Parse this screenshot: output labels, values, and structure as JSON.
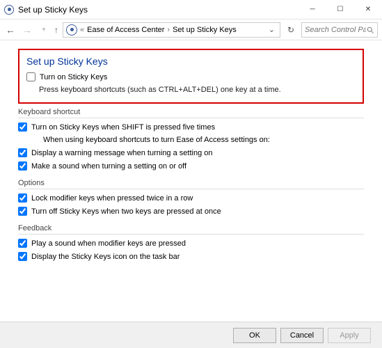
{
  "window": {
    "title": "Set up Sticky Keys"
  },
  "breadcrumb": {
    "item1": "Ease of Access Center",
    "item2": "Set up Sticky Keys"
  },
  "search": {
    "placeholder": "Search Control Pan..."
  },
  "hero": {
    "title": "Set up Sticky Keys",
    "checkbox_label": "Turn on Sticky Keys",
    "checked": false,
    "description": "Press keyboard shortcuts (such as CTRL+ALT+DEL) one key at a time."
  },
  "sections": {
    "shortcut": {
      "title": "Keyboard shortcut",
      "opt1": "Turn on Sticky Keys when SHIFT is pressed five times",
      "subtext": "When using keyboard shortcuts to turn Ease of Access settings on:",
      "opt2": "Display a warning message when turning a setting on",
      "opt3": "Make a sound when turning a setting on or off"
    },
    "options": {
      "title": "Options",
      "opt1": "Lock modifier keys when pressed twice in a row",
      "opt2": "Turn off Sticky Keys when two keys are pressed at once"
    },
    "feedback": {
      "title": "Feedback",
      "opt1": "Play a sound when modifier keys are pressed",
      "opt2": "Display the Sticky Keys icon on the task bar"
    }
  },
  "buttons": {
    "ok": "OK",
    "cancel": "Cancel",
    "apply": "Apply"
  }
}
